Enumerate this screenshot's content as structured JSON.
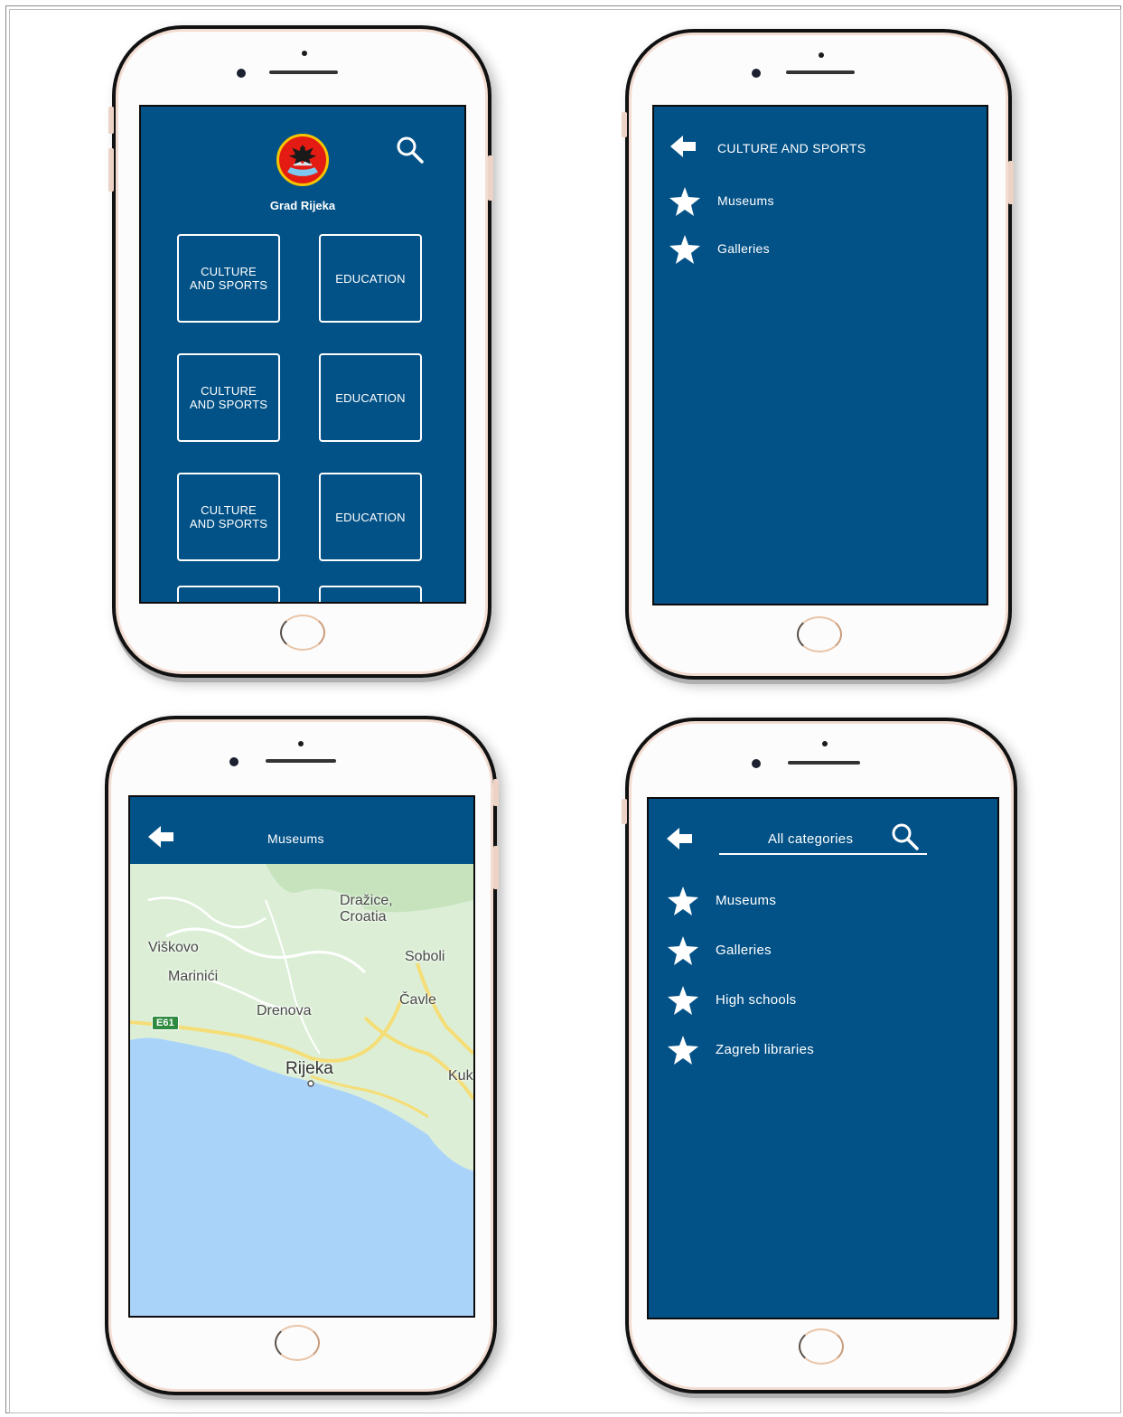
{
  "colors": {
    "app_blue": "#035287",
    "white": "#ffffff",
    "map_water": "#aad3fa",
    "map_land": "#dcefd6",
    "road": "#f5dd77"
  },
  "phone1": {
    "app_title": "Grad Rijeka",
    "search_icon": "search-icon",
    "logo_icon": "coat-of-arms-icon",
    "categories": [
      {
        "label": "CULTURE AND SPORTS"
      },
      {
        "label": "EDUCATION"
      },
      {
        "label": "CULTURE AND SPORTS"
      },
      {
        "label": "EDUCATION"
      },
      {
        "label": "CULTURE AND SPORTS"
      },
      {
        "label": "EDUCATION"
      }
    ]
  },
  "phone2": {
    "header": "CULTURE AND SPORTS",
    "back_icon": "back-arrow-icon",
    "items": [
      {
        "label": "Museums",
        "icon": "star-icon"
      },
      {
        "label": "Galleries",
        "icon": "star-icon"
      }
    ]
  },
  "phone3": {
    "header": "Museums",
    "back_icon": "back-arrow-icon",
    "map_labels": {
      "drazice": "Dražice,\nCroatia",
      "viskovo": "Viškovo",
      "soboli": "Soboli",
      "marinici": "Marinići",
      "cavle": "Čavle",
      "drenova": "Drenova",
      "rijeka": "Rijeka",
      "kuk": "Kuk",
      "route": "E61"
    }
  },
  "phone4": {
    "search_text": "All categories",
    "back_icon": "back-arrow-icon",
    "search_icon": "search-icon",
    "items": [
      {
        "label": "Museums",
        "icon": "star-icon"
      },
      {
        "label": "Galleries",
        "icon": "star-icon"
      },
      {
        "label": "High schools",
        "icon": "star-icon"
      },
      {
        "label": "Zagreb libraries",
        "icon": "star-icon"
      }
    ]
  }
}
